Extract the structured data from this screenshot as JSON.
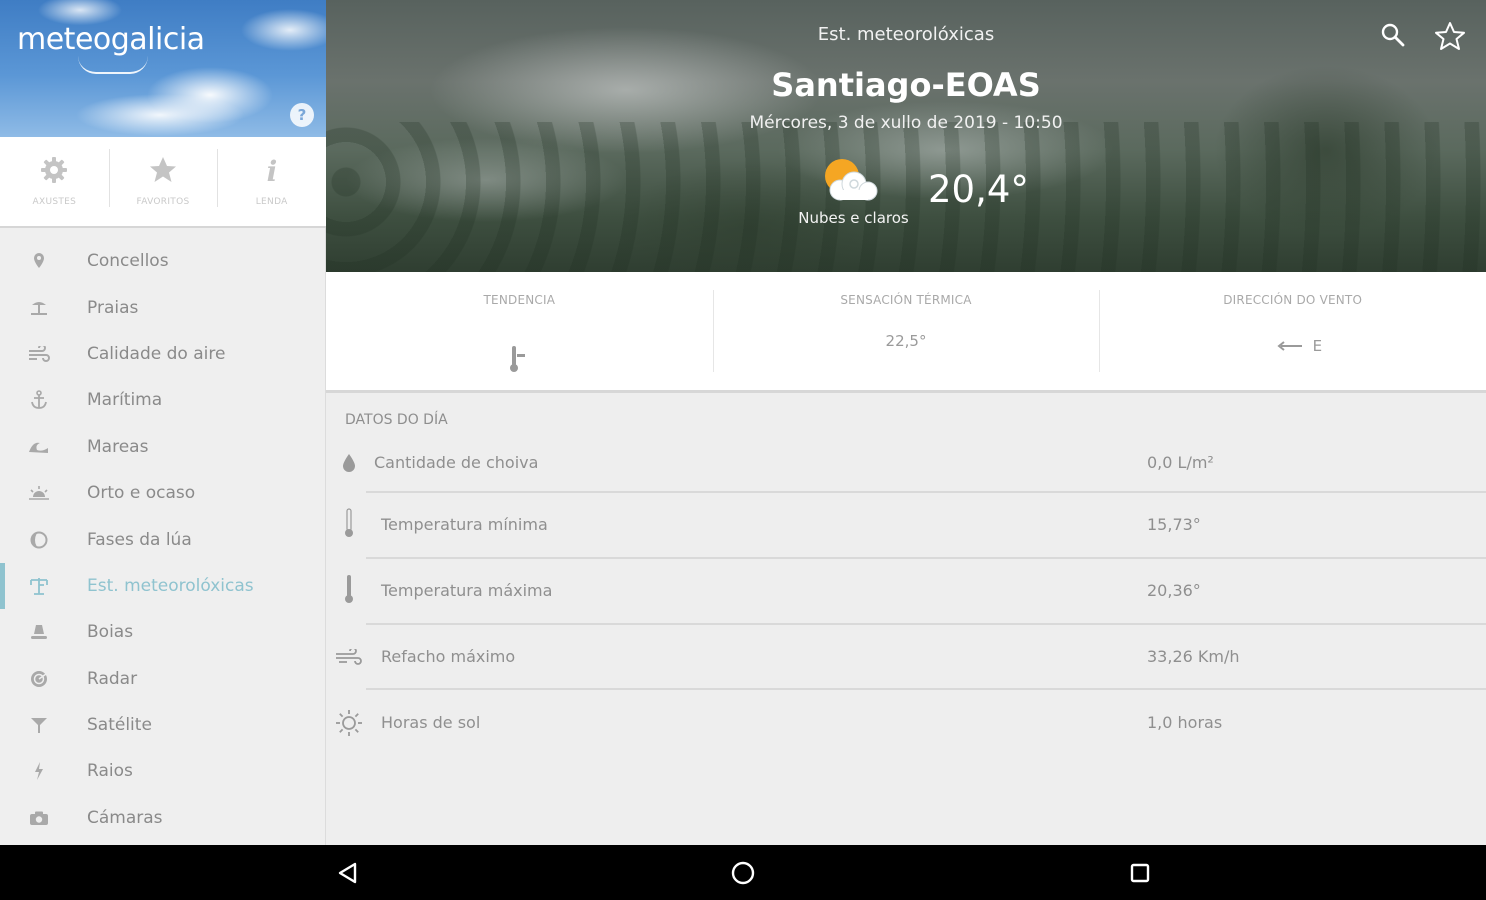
{
  "app": {
    "brand": "meteogalicia",
    "help_badge": "?"
  },
  "quick_actions": [
    {
      "label": "AXUSTES",
      "icon": "gear-icon"
    },
    {
      "label": "FAVORITOS",
      "icon": "star-icon"
    },
    {
      "label": "LENDA",
      "icon": "info-icon"
    }
  ],
  "menu": {
    "active": "Est. meteorolóxicas",
    "items": [
      {
        "label": "Concellos",
        "icon": "location-pin-icon"
      },
      {
        "label": "Praias",
        "icon": "beach-icon"
      },
      {
        "label": "Calidade do aire",
        "icon": "air-quality-icon"
      },
      {
        "label": "Marítima",
        "icon": "anchor-icon"
      },
      {
        "label": "Mareas",
        "icon": "wave-icon"
      },
      {
        "label": "Orto e ocaso",
        "icon": "sunrise-icon"
      },
      {
        "label": "Fases da lúa",
        "icon": "moon-icon"
      },
      {
        "label": "Est. meteorolóxicas",
        "icon": "weather-station-icon"
      },
      {
        "label": "Boias",
        "icon": "buoy-icon"
      },
      {
        "label": "Radar",
        "icon": "radar-icon"
      },
      {
        "label": "Satélite",
        "icon": "satellite-icon"
      },
      {
        "label": "Raios",
        "icon": "lightning-icon"
      },
      {
        "label": "Cámaras",
        "icon": "camera-icon"
      }
    ]
  },
  "header": {
    "section_title": "Est. meteorolóxicas",
    "station_name": "Santiago-EOAS",
    "datetime": "Mércores, 3 de xullo de 2019 - 10:50",
    "weather_desc": "Nubes e claros",
    "weather_icon": "sun-cloud-icon",
    "temperature": "20,4°"
  },
  "stats": [
    {
      "label": "TENDENCIA",
      "value": "",
      "icon": "thermometer-trend-icon"
    },
    {
      "label": "SENSACIÓN TÉRMICA",
      "value": "22,5°"
    },
    {
      "label": "DIRECCIÓN DO VENTO",
      "value": "E",
      "icon": "wind-arrow-icon"
    }
  ],
  "day_data": {
    "title": "DATOS DO DÍA",
    "rows": [
      {
        "label": "Cantidade de choiva",
        "value": "0,0 L/m²",
        "icon": "raindrop-icon"
      },
      {
        "label": "Temperatura mínima",
        "value": "15,73°",
        "icon": "thermometer-low-icon"
      },
      {
        "label": "Temperatura máxima",
        "value": "20,36°",
        "icon": "thermometer-high-icon"
      },
      {
        "label": "Refacho máximo",
        "value": "33,26 Km/h",
        "icon": "wind-gust-icon"
      },
      {
        "label": "Horas de sol",
        "value": "1,0 horas",
        "icon": "sun-icon"
      }
    ]
  },
  "colors": {
    "accent": "#8fc3cf",
    "sun": "#f5a623"
  }
}
